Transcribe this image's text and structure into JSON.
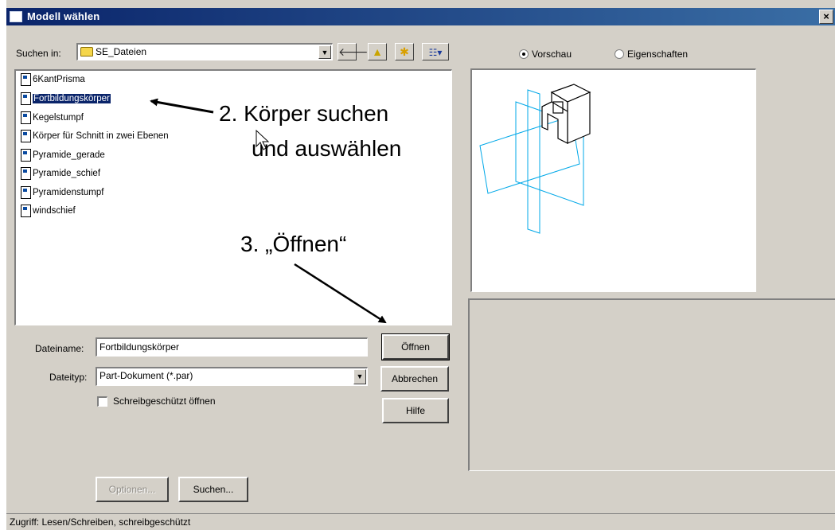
{
  "window": {
    "title": "Modell wählen",
    "close_label": "×"
  },
  "lookin": {
    "label": "Suchen in:",
    "value": "SE_Dateien",
    "toolbar_icons": [
      "back-arrow-icon",
      "up-folder-icon",
      "new-folder-icon",
      "view-menu-icon"
    ]
  },
  "files": [
    {
      "name": "6KantPrisma",
      "selected": false
    },
    {
      "name": "Fortbildungskörper",
      "selected": true
    },
    {
      "name": "Kegelstumpf",
      "selected": false
    },
    {
      "name": "Körper für Schnitt in zwei Ebenen",
      "selected": false
    },
    {
      "name": "Pyramide_gerade",
      "selected": false
    },
    {
      "name": "Pyramide_schief",
      "selected": false
    },
    {
      "name": "Pyramidenstumpf",
      "selected": false
    },
    {
      "name": "windschief",
      "selected": false
    }
  ],
  "annotations": {
    "step2_line1": "2. Körper suchen",
    "step2_line2": "und auswählen",
    "step3": "3. „Öffnen“"
  },
  "form": {
    "filename_label": "Dateiname:",
    "filename_value": "Fortbildungskörper",
    "filetype_label": "Dateityp:",
    "filetype_value": "Part-Dokument (*.par)",
    "readonly_label": "Schreibgeschützt öffnen",
    "readonly_checked": false
  },
  "buttons": {
    "open": "Öffnen",
    "cancel": "Abbrechen",
    "help": "Hilfe",
    "options": "Optionen...",
    "search": "Suchen..."
  },
  "view_mode": {
    "preview_label": "Vorschau",
    "properties_label": "Eigenschaften",
    "selected": "preview"
  },
  "status": {
    "text": "Zugriff: Lesen/Schreiben, schreibgeschützt"
  },
  "colors": {
    "selection": "#0a246a",
    "preview_cyan": "#00a8e8",
    "dialog_bg": "#d4d0c8"
  }
}
